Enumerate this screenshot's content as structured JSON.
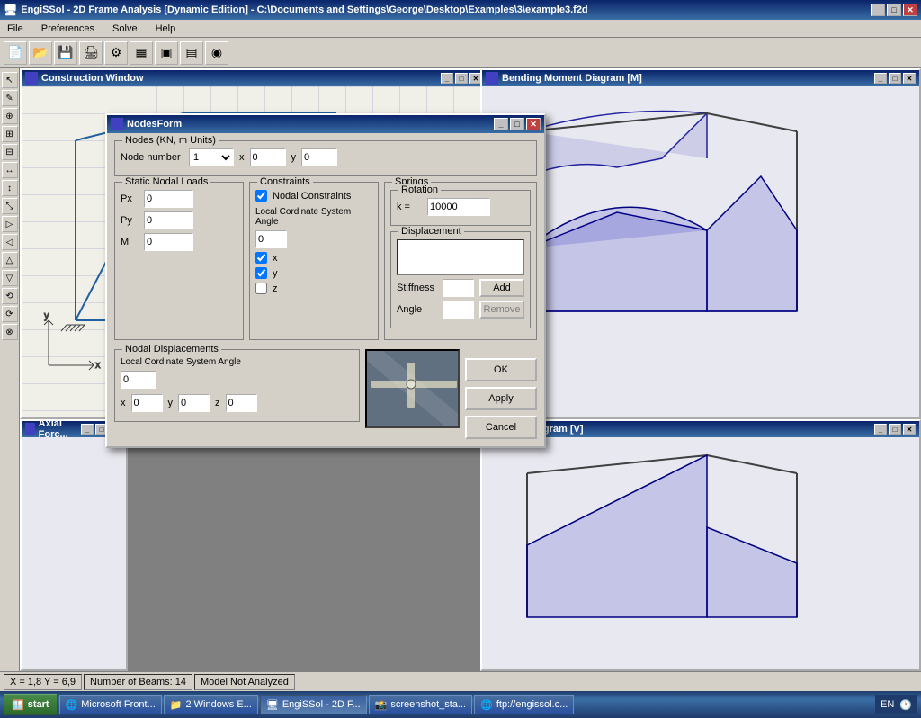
{
  "app": {
    "title": "EngiSSol - 2D Frame Analysis [Dynamic Edition] - C:\\Documents and Settings\\George\\Desktop\\Examples\\3\\example3.f2d",
    "icon": "E"
  },
  "menu": {
    "items": [
      "File",
      "Preferences",
      "Solve",
      "Help"
    ]
  },
  "construction_window": {
    "title": "Construction Window"
  },
  "bending_window": {
    "title": "Bending Moment Diagram [M]"
  },
  "axial_window": {
    "title": "Axial Forc..."
  },
  "shear_window": {
    "title": "...rce Diagram [V]"
  },
  "nodes_form": {
    "title": "NodesForm",
    "group_nodes_label": "Nodes (KN, m Units)",
    "node_number_label": "Node number",
    "node_number_value": "1",
    "x_label": "x",
    "x_value": "0",
    "y_label": "y",
    "y_value": "0",
    "static_nodal_loads_label": "Static Nodal Loads",
    "px_label": "Px",
    "px_value": "0",
    "py_label": "Py",
    "py_value": "0",
    "m_label": "M",
    "m_value": "0",
    "constraints_label": "Constraints",
    "nodal_constraints_label": "Nodal Constraints",
    "nodal_constraints_checked": true,
    "local_cordinate_label": "Local Cordinate System Angle",
    "local_angle_value": "0",
    "checkbox_x_label": "x",
    "checkbox_x_checked": true,
    "checkbox_y_label": "y",
    "checkbox_y_checked": true,
    "checkbox_z_label": "z",
    "checkbox_z_checked": false,
    "springs_label": "Springs",
    "rotation_label": "Rotation",
    "k_label": "k =",
    "k_value": "10000",
    "displacement_label": "Displacement",
    "stiffness_label": "Stiffness",
    "stiffness_value": "",
    "add_label": "Add",
    "angle_label": "Angle",
    "angle_value": "",
    "remove_label": "Remove",
    "nodal_displacements_label": "Nodal Displacements",
    "local_cordinate_system_label": "Local Cordinate System Angle",
    "local_disp_angle_value": "0",
    "disp_x_label": "x",
    "disp_x_value": "0",
    "disp_y_label": "y",
    "disp_y_value": "0",
    "disp_z_label": "z",
    "disp_z_value": "0",
    "ok_label": "OK",
    "apply_label": "Apply",
    "cancel_label": "Cancel"
  },
  "status_bar": {
    "coordinates": "X = 1,8   Y = 6,9",
    "beams": "Number of Beams: 14",
    "analysis": "Model Not Analyzed"
  },
  "taskbar": {
    "start_label": "start",
    "items": [
      {
        "label": "Microsoft Front...",
        "icon": "IE"
      },
      {
        "label": "2 Windows E...",
        "icon": "F"
      },
      {
        "label": "EngiSSol - 2D F...",
        "icon": "E",
        "active": true
      },
      {
        "label": "screenshot_sta...",
        "icon": "S"
      },
      {
        "label": "ftp://engissol.c...",
        "icon": "IE"
      }
    ],
    "tray": {
      "lang": "EN",
      "time": ""
    }
  }
}
